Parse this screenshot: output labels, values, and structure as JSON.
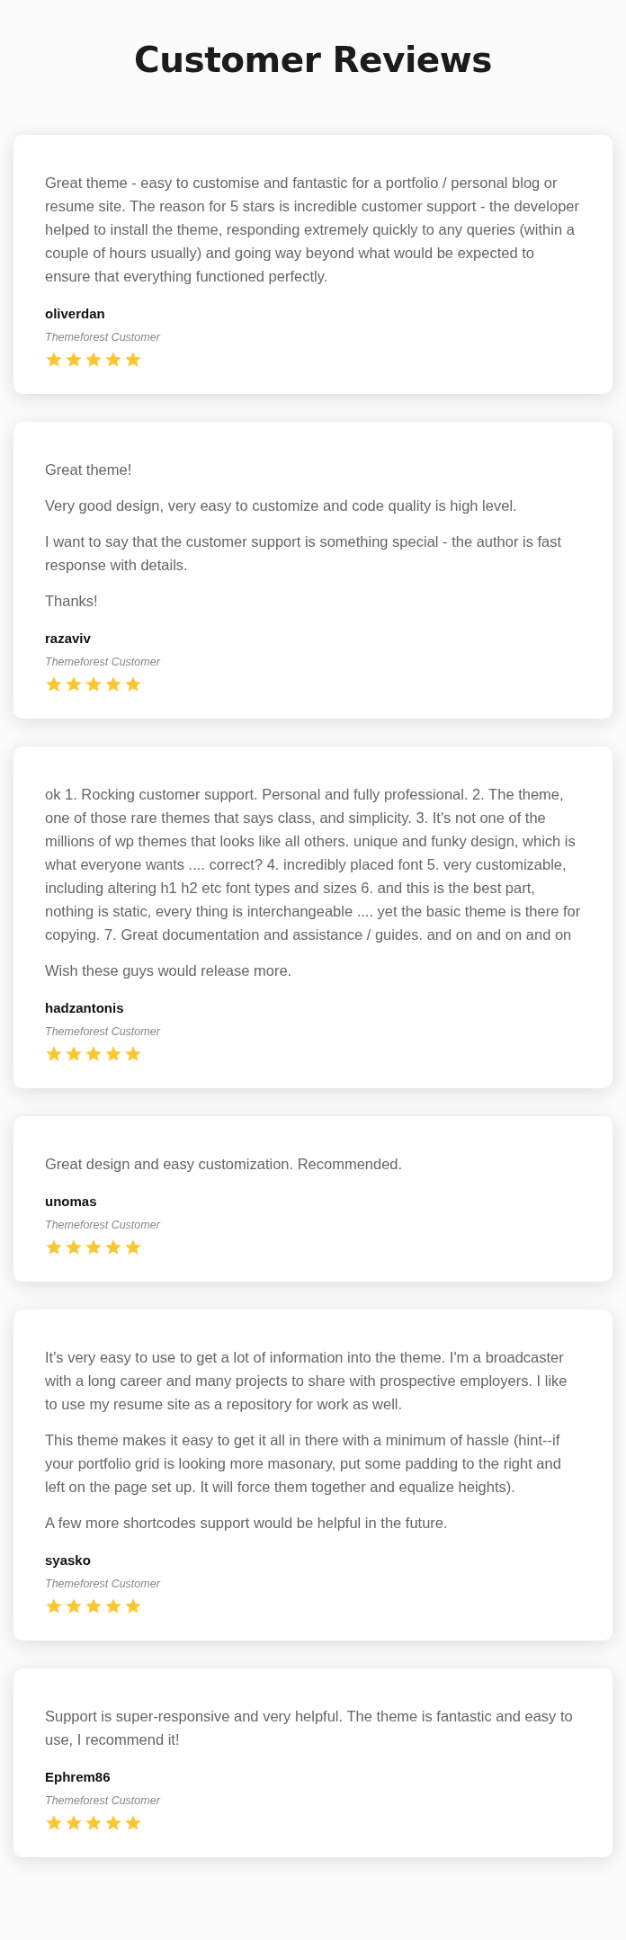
{
  "title": "Customer Reviews",
  "reviews": [
    {
      "paragraphs": [
        "Great theme - easy to customise and fantastic for a portfolio / personal blog or resume site. The reason for 5 stars is incredible customer support - the developer helped to install the theme, responding extremely quickly to any queries (within a couple of hours usually) and going way beyond what would be expected to ensure that everything functioned perfectly."
      ],
      "author": "oliverdan",
      "source": "Themeforest Customer",
      "stars": 5
    },
    {
      "paragraphs": [
        "Great theme!",
        "Very good design, very easy to customize and code quality is high level.",
        "I want to say that the customer support is something special - the author is fast response with details.",
        "Thanks!"
      ],
      "author": "razaviv",
      "source": "Themeforest Customer",
      "stars": 5
    },
    {
      "paragraphs": [
        "ok 1. Rocking customer support. Personal and fully professional. 2. The theme, one of those rare themes that says class, and simplicity. 3. It's not one of the millions of wp themes that looks like all others. unique and funky design, which is what everyone wants .... correct? 4. incredibly placed font 5. very customizable, including altering h1 h2 etc font types and sizes 6. and this is the best part, nothing is static, every thing is interchangeable .... yet the basic theme is there for copying. 7. Great documentation and assistance / guides. and on and on and on",
        "Wish these guys would release more."
      ],
      "author": "hadzantonis",
      "source": "Themeforest Customer",
      "stars": 5
    },
    {
      "paragraphs": [
        "Great design and easy customization. Recommended."
      ],
      "author": "unomas",
      "source": "Themeforest Customer",
      "stars": 5
    },
    {
      "paragraphs": [
        "It's very easy to use to get a lot of information into the theme. I'm a broadcaster with a long career and many projects to share with prospective employers. I like to use my resume site as a repository for work as well.",
        "This theme makes it easy to get it all in there with a minimum of hassle (hint--if your portfolio grid is looking more masonary, put some padding to the right and left on the page set up. It will force them together and equalize heights).",
        "A few more shortcodes support would be helpful in the future."
      ],
      "author": "syasko",
      "source": "Themeforest Customer",
      "stars": 5
    },
    {
      "paragraphs": [
        "Support is super-responsive and very helpful. The theme is fantastic and easy to use, I recommend it!"
      ],
      "author": "Ephrem86",
      "source": "Themeforest Customer",
      "stars": 5
    }
  ]
}
